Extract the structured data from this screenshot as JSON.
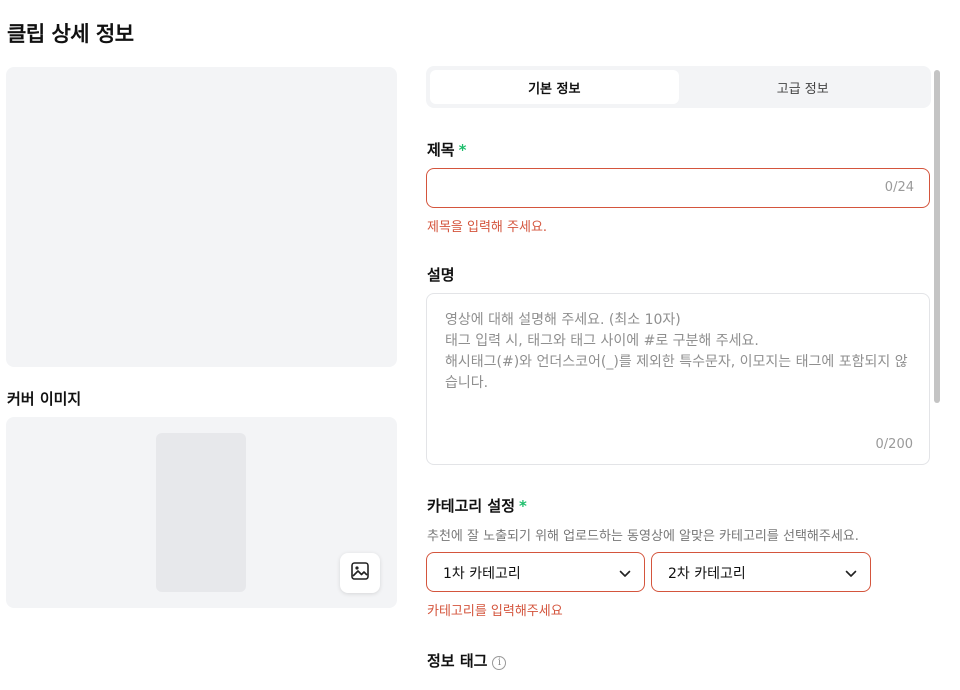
{
  "page": {
    "title": "클립 상세 정보"
  },
  "left": {
    "cover_label": "커버 이미지"
  },
  "tabs": [
    {
      "label": "기본 정보",
      "active": true
    },
    {
      "label": "고급 정보",
      "active": false
    }
  ],
  "title_field": {
    "label": "제목",
    "required_mark": "*",
    "value": "",
    "counter": "0/24",
    "error": "제목을 입력해 주세요."
  },
  "description_field": {
    "label": "설명",
    "placeholder": "영상에 대해 설명해 주세요. (최소 10자)\n태그 입력 시, 태그와 태그 사이에 #로 구분해 주세요.\n해시태그(#)와 언더스코어(_)를 제외한 특수문자, 이모지는 태그에 포함되지 않습니다.",
    "counter": "0/200"
  },
  "category": {
    "label": "카테고리 설정",
    "required_mark": "*",
    "help": "추천에 잘 노출되기 위해 업로드하는 동영상에 알맞은 카테고리를 선택해주세요.",
    "primary": "1차 카테고리",
    "secondary": "2차 카테고리",
    "error": "카테고리를 입력해주세요"
  },
  "info_tag": {
    "label": "정보 태그",
    "info_icon": "i"
  },
  "icons": {
    "image": "image-icon",
    "chevron": "chevron-down-icon",
    "info": "info-icon"
  },
  "colors": {
    "error": "#d4553d",
    "required": "#1ebe6c",
    "panel_bg": "#f3f4f6"
  }
}
